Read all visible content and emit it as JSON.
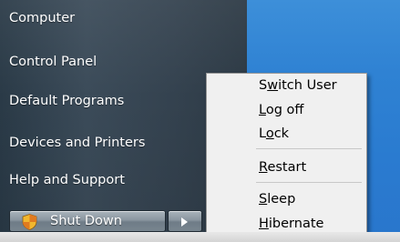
{
  "start_menu": {
    "right_pane_items": [
      {
        "label": "Computer"
      },
      {
        "label": "Control Panel"
      },
      {
        "label": "Default Programs"
      },
      {
        "label": "Devices and Printers"
      },
      {
        "label": "Help and Support"
      }
    ],
    "shutdown": {
      "label": "Shut Down",
      "icon": "security-shield-icon",
      "arrow_icon": "play-arrow-icon"
    }
  },
  "power_submenu": {
    "items": [
      {
        "pre": "S",
        "key": "w",
        "post": "itch User"
      },
      {
        "pre": "",
        "key": "L",
        "post": "og off"
      },
      {
        "pre": "L",
        "key": "o",
        "post": "ck"
      },
      {
        "pre": "",
        "key": "R",
        "post": "estart"
      },
      {
        "pre": "",
        "key": "S",
        "post": "leep"
      },
      {
        "pre": "",
        "key": "H",
        "post": "ibernate"
      }
    ]
  },
  "colors": {
    "panel": "#34424f",
    "desktop_blue": "#2f82d3",
    "submenu_bg": "#f0f0f0",
    "shield_yellow": "#f2b72e",
    "shield_orange": "#e07a1f"
  }
}
